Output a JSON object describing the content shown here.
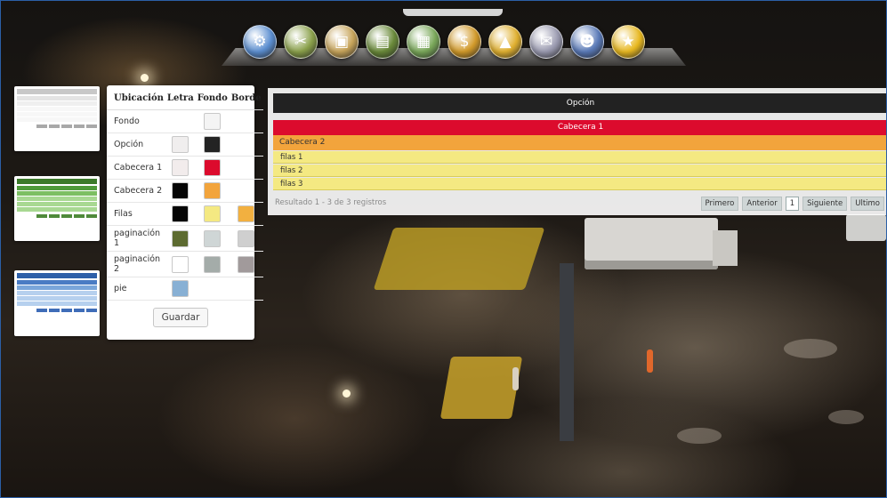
{
  "dock": {
    "icons": [
      {
        "name": "settings-gears-icon",
        "glyph": "⚙",
        "color": "#5b8ed0"
      },
      {
        "name": "tools-icon",
        "glyph": "✂",
        "color": "#8aa04a"
      },
      {
        "name": "box-icon",
        "glyph": "▣",
        "color": "#c7a45a"
      },
      {
        "name": "database-icon",
        "glyph": "▤",
        "color": "#6a8a3a"
      },
      {
        "name": "files-icon",
        "glyph": "▦",
        "color": "#7aa85a"
      },
      {
        "name": "money-chart-icon",
        "glyph": "$",
        "color": "#d29a2a"
      },
      {
        "name": "warning-icon",
        "glyph": "▲",
        "color": "#e0b030"
      },
      {
        "name": "mail-icon",
        "glyph": "✉",
        "color": "#9a9ab0"
      },
      {
        "name": "users-icon",
        "glyph": "☻",
        "color": "#5a7ab8"
      },
      {
        "name": "star-icon",
        "glyph": "★",
        "color": "#e8b820"
      }
    ]
  },
  "themes": [
    {
      "name": "theme-gray",
      "head": "#c8c8c8",
      "cab1": "#e4e4e4",
      "cab2": "#efefef",
      "row": "#f7f7f7",
      "foot": "#a8a8a8"
    },
    {
      "name": "theme-green",
      "head": "#3c7a2a",
      "cab1": "#4f9a3a",
      "cab2": "#7cbf62",
      "row": "#a8d892",
      "foot": "#4f8a3a"
    },
    {
      "name": "theme-blue",
      "head": "#2d5fa8",
      "cab1": "#4a7cc4",
      "cab2": "#7aa6da",
      "row": "#b6d0ee",
      "foot": "#3f6db8"
    }
  ],
  "config": {
    "headers": {
      "ubicacion": "Ubicación",
      "letra": "Letra",
      "fondo": "Fondo",
      "borde": "Borde"
    },
    "rows": [
      {
        "label": "Fondo",
        "letra": null,
        "fondo": "#f4f4f4",
        "borde": null
      },
      {
        "label": "Opción",
        "letra": "#f0eeee",
        "fondo": "#232323",
        "borde": null
      },
      {
        "label": "Cabecera 1",
        "letra": "#f2ecec",
        "fondo": "#dc0b2d",
        "borde": null
      },
      {
        "label": "Cabecera 2",
        "letra": "#050505",
        "fondo": "#f2a43c",
        "borde": null
      },
      {
        "label": "Filas",
        "letra": "#050505",
        "fondo": "#f4e982",
        "borde": "#f2b040"
      },
      {
        "label": "paginación 1",
        "letra": "#5d6b31",
        "fondo": "#cfd6d6",
        "borde": "#cfcfcf"
      },
      {
        "label": "paginación 2",
        "letra": "#ffffff",
        "fondo": "#a4aca9",
        "borde": "#a19a9b"
      },
      {
        "label": "pie",
        "letra": "#88b0d4",
        "fondo": null,
        "borde": null
      }
    ],
    "save_label": "Guardar"
  },
  "preview": {
    "option": "Opción",
    "cabecera1": "Cabecera 1",
    "cabecera2": "Cabecera 2",
    "rows": [
      "filas 1",
      "filas 2",
      "filas 3"
    ],
    "result": "Resultado 1 - 3 de 3 registros",
    "pager": {
      "first": "Primero",
      "prev": "Anterior",
      "current": "1",
      "next": "Siguiente",
      "last": "Ultimo"
    }
  }
}
